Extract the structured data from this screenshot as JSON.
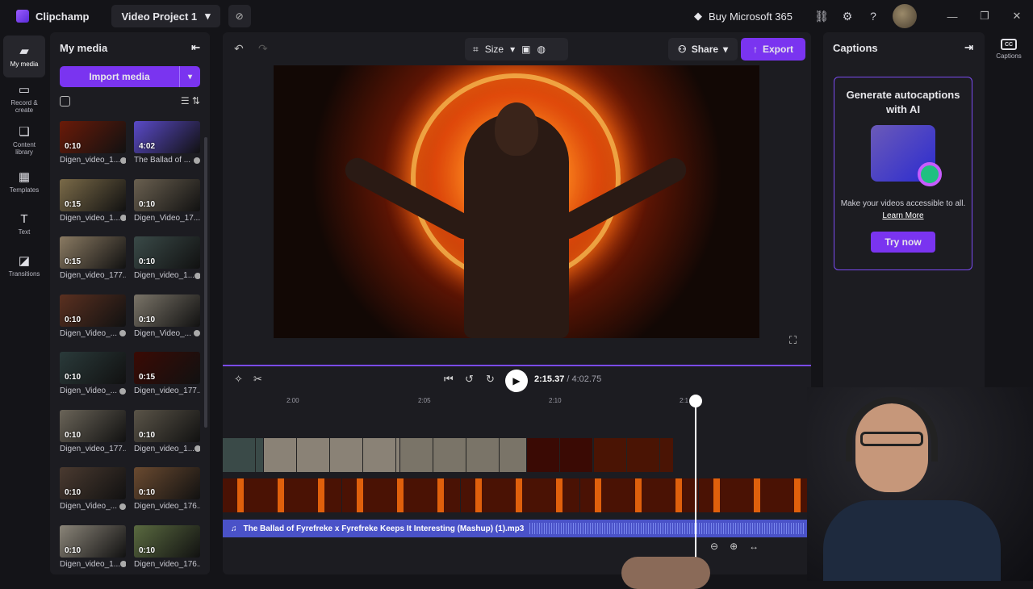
{
  "app": {
    "name": "Clipchamp",
    "project": "Video Project 1",
    "buy": "Buy Microsoft 365"
  },
  "nav": [
    {
      "label": "My media",
      "icon": "folder-icon"
    },
    {
      "label": "Record & create",
      "icon": "camera-icon"
    },
    {
      "label": "Content library",
      "icon": "library-icon"
    },
    {
      "label": "Templates",
      "icon": "templates-icon"
    },
    {
      "label": "Text",
      "icon": "text-icon"
    },
    {
      "label": "Transitions",
      "icon": "transitions-icon"
    }
  ],
  "media": {
    "title": "My media",
    "import_label": "Import media",
    "items": [
      {
        "name": "Digen_video_1...",
        "dur": "0:10",
        "color": "#6a1a08"
      },
      {
        "name": "The Ballad of ...",
        "dur": "4:02",
        "color": "#5a4ac8"
      },
      {
        "name": "Digen_video_1...",
        "dur": "0:15",
        "color": "#7a6a48"
      },
      {
        "name": "Digen_Video_17...",
        "dur": "0:10",
        "color": "#6a6050"
      },
      {
        "name": "Digen_video_177...",
        "dur": "0:15",
        "color": "#8a7a62"
      },
      {
        "name": "Digen_video_1...",
        "dur": "0:10",
        "color": "#3a4a48"
      },
      {
        "name": "Digen_Video_...",
        "dur": "0:10",
        "color": "#5a3020"
      },
      {
        "name": "Digen_Video_...",
        "dur": "0:10",
        "color": "#7a7468"
      },
      {
        "name": "Digen_Video_...",
        "dur": "0:10",
        "color": "#2a3a3a"
      },
      {
        "name": "Digen_video_177...",
        "dur": "0:15",
        "color": "#3a0a04"
      },
      {
        "name": "Digen_video_177...",
        "dur": "0:10",
        "color": "#6a6458"
      },
      {
        "name": "Digen_video_1...",
        "dur": "0:10",
        "color": "#5a5448"
      },
      {
        "name": "Digen_Video_...",
        "dur": "0:10",
        "color": "#4a3a30"
      },
      {
        "name": "Digen_video_176...",
        "dur": "0:10",
        "color": "#6a4a30"
      },
      {
        "name": "Digen_video_1...",
        "dur": "0:10",
        "color": "#8a8478"
      },
      {
        "name": "Digen_video_176...",
        "dur": "0:10",
        "color": "#5a6a40"
      }
    ]
  },
  "editor": {
    "size_label": "Size",
    "share_label": "Share",
    "export_label": "Export",
    "time_current": "2:15.37",
    "time_total": "/ 4:02.75",
    "ruler": [
      "2:00",
      "2:05",
      "2:10",
      "2:1"
    ],
    "audio_label": "The Ballad of Fyrefreke x Fyrefreke Keeps It Interesting (Mashup) (1).mp3"
  },
  "captions": {
    "title": "Captions",
    "card_title": "Generate autocaptions with AI",
    "desc": "Make your videos accessible to all.",
    "link": "Learn More",
    "button": "Try now",
    "rail_label": "Captions"
  }
}
